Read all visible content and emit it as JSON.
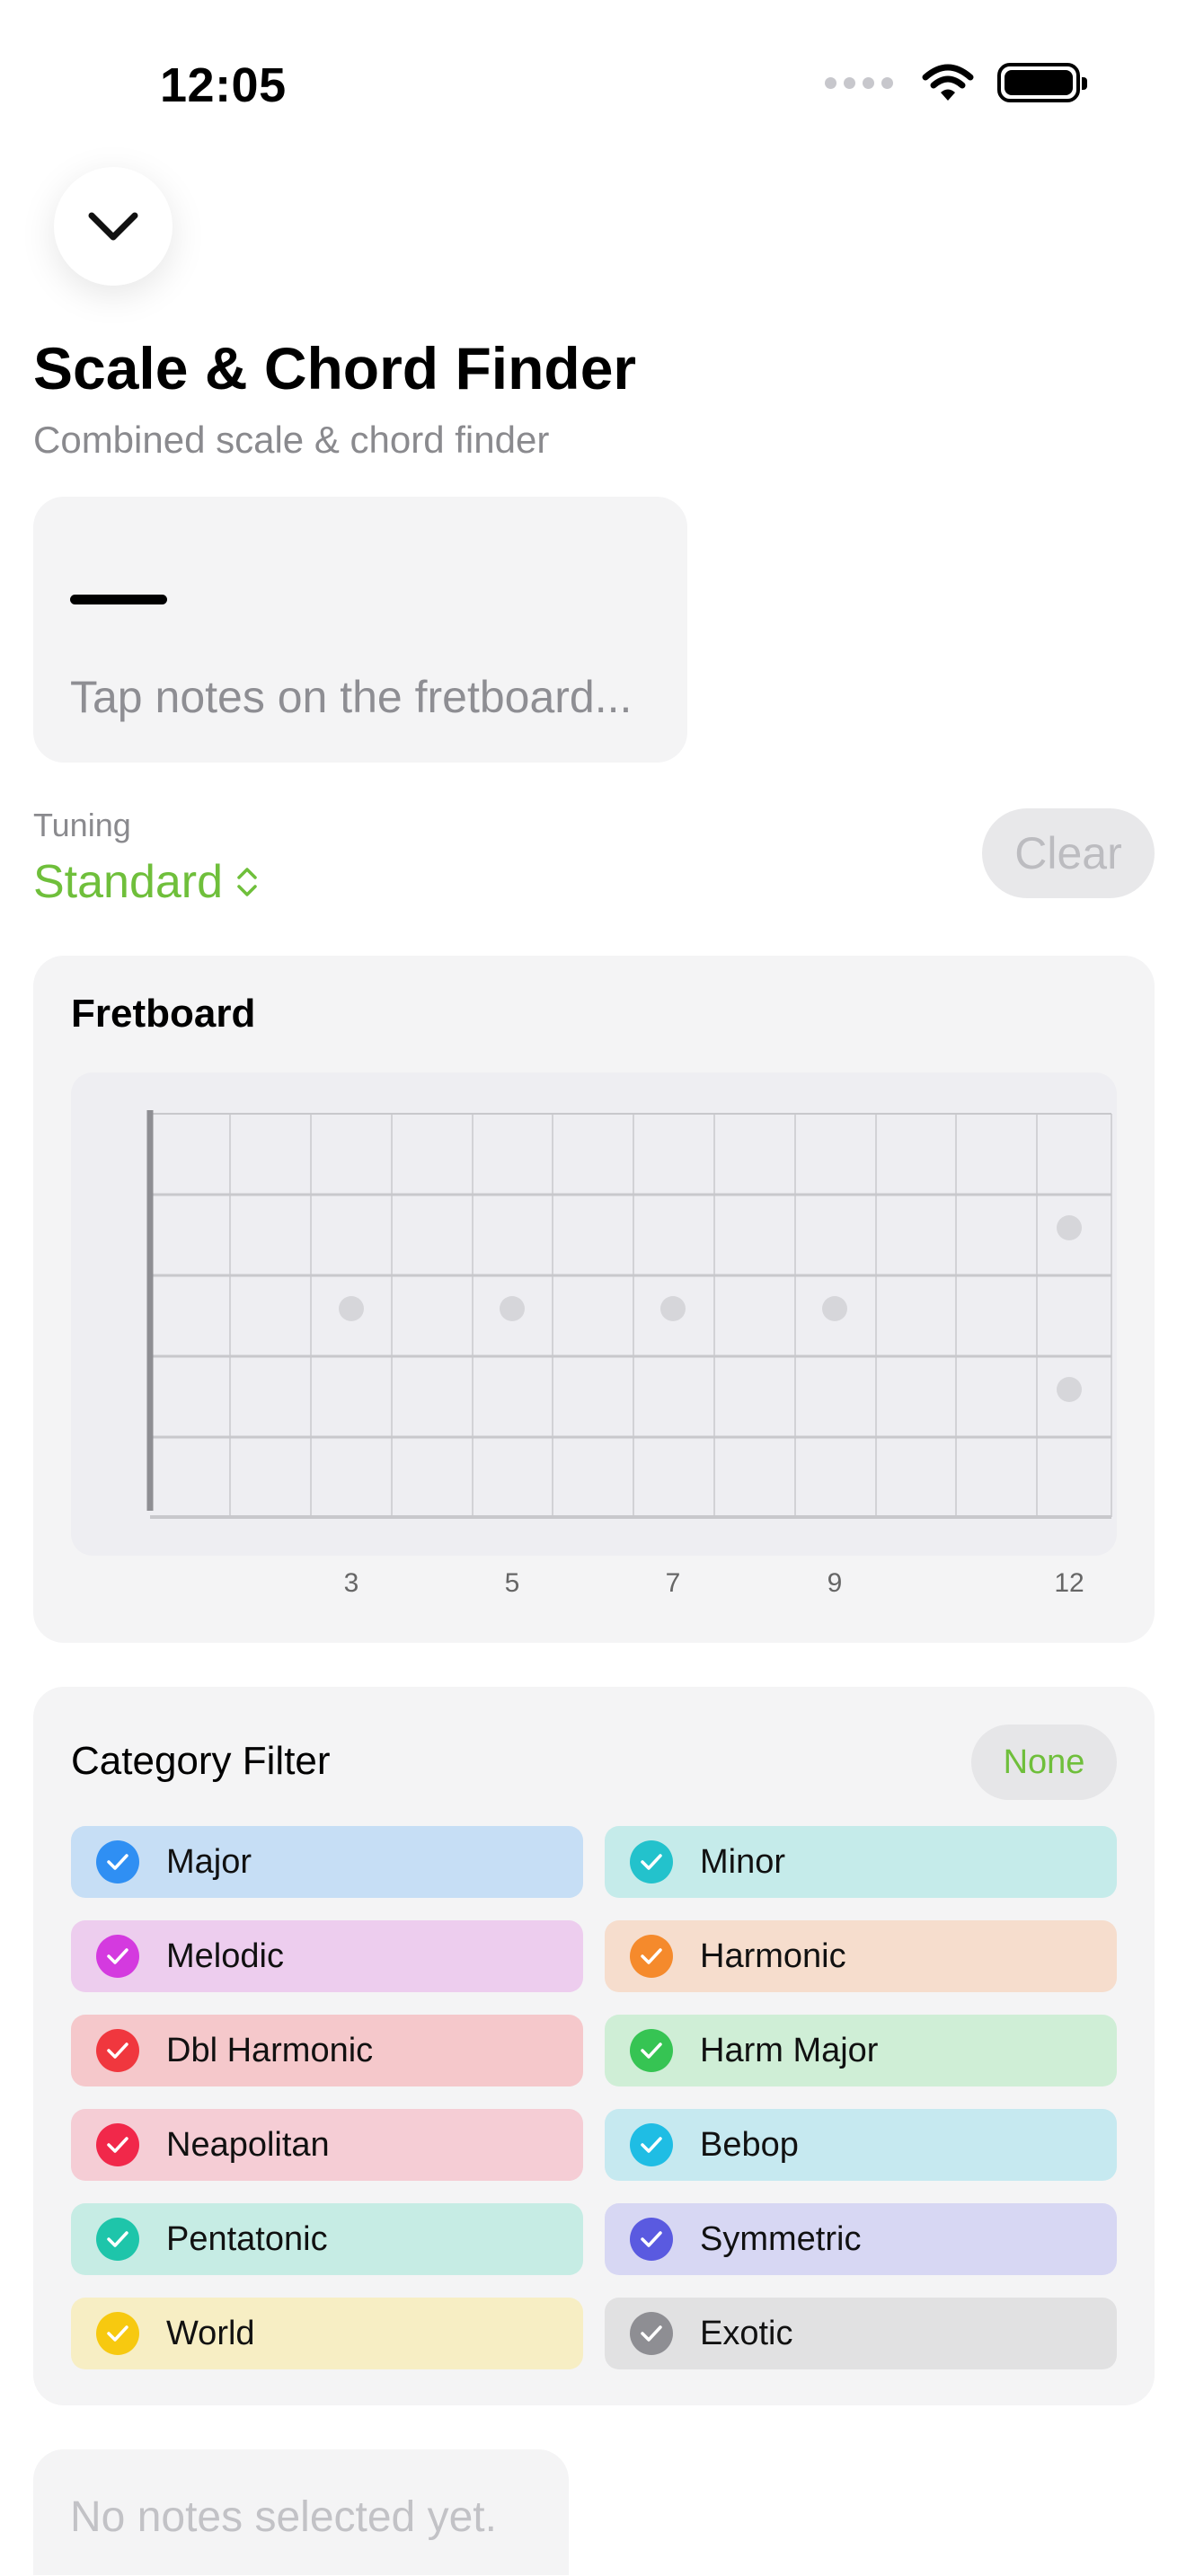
{
  "status_bar": {
    "time": "12:05"
  },
  "header": {
    "title": "Scale & Chord Finder",
    "subtitle": "Combined scale & chord finder"
  },
  "selection": {
    "placeholder": "Tap notes on the fretboard..."
  },
  "tuning": {
    "label": "Tuning",
    "value": "Standard",
    "clear_label": "Clear"
  },
  "fretboard": {
    "title": "Fretboard",
    "fret_markers": [
      "3",
      "5",
      "7",
      "9",
      "12"
    ]
  },
  "category_filter": {
    "title": "Category Filter",
    "none_label": "None",
    "items": [
      {
        "label": "Major",
        "color": "#2f8ff3",
        "bg": "#c6def5",
        "checked": true
      },
      {
        "label": "Minor",
        "color": "#23c2cc",
        "bg": "#c5ebea",
        "checked": true
      },
      {
        "label": "Melodic",
        "color": "#d43adf",
        "bg": "#edcdee",
        "checked": true
      },
      {
        "label": "Harmonic",
        "color": "#f58a2c",
        "bg": "#f6ddcd",
        "checked": true
      },
      {
        "label": "Dbl Harmonic",
        "color": "#f0373e",
        "bg": "#f5c8cb",
        "checked": true
      },
      {
        "label": "Harm Major",
        "color": "#36c453",
        "bg": "#cfeed6",
        "checked": true
      },
      {
        "label": "Neapolitan",
        "color": "#f1284a",
        "bg": "#f5cdd5",
        "checked": true
      },
      {
        "label": "Bebop",
        "color": "#1fbde4",
        "bg": "#c6e9f0",
        "checked": true
      },
      {
        "label": "Pentatonic",
        "color": "#1ec5aa",
        "bg": "#c6ece4",
        "checked": true
      },
      {
        "label": "Symmetric",
        "color": "#5a5ae0",
        "bg": "#d7d7f3",
        "checked": true
      },
      {
        "label": "World",
        "color": "#f7c910",
        "bg": "#f7eec4",
        "checked": true
      },
      {
        "label": "Exotic",
        "color": "#8e8e93",
        "bg": "#e1e1e2",
        "checked": true
      }
    ]
  },
  "results": {
    "empty_message": "No notes selected yet."
  },
  "colors": {
    "accent": "#6fbf3b",
    "card_bg": "#f4f4f5",
    "secondary_text": "#8a8a8e"
  }
}
